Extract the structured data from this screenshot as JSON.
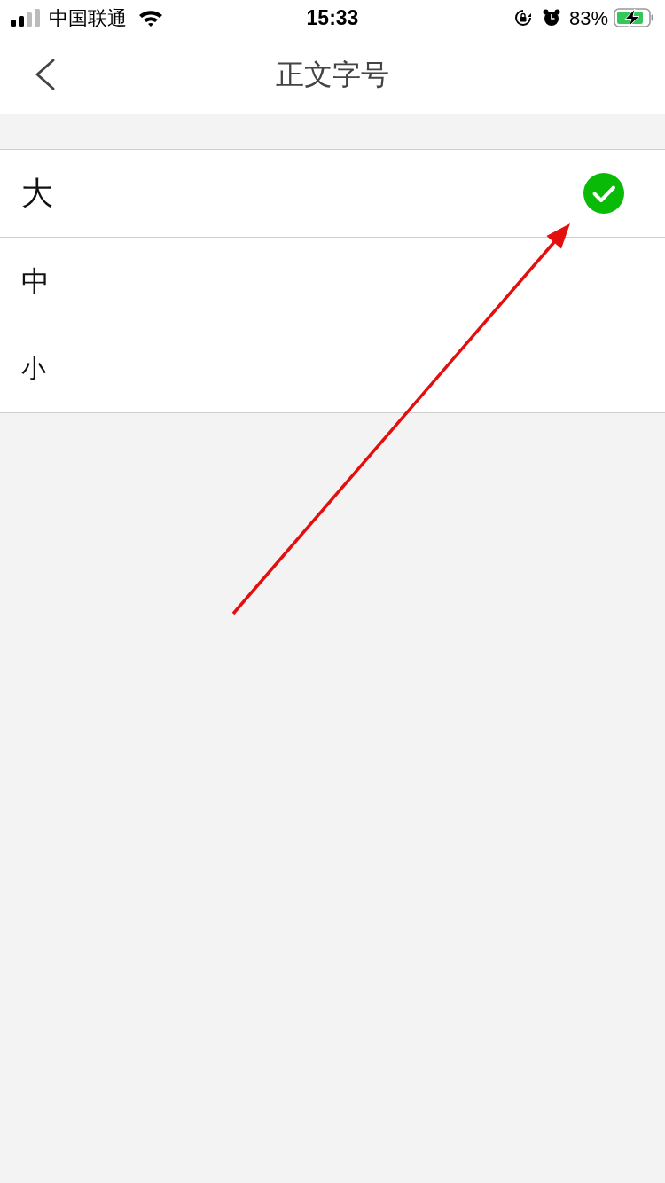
{
  "status_bar": {
    "carrier": "中国联通",
    "time": "15:33",
    "battery_percent": "83%"
  },
  "nav": {
    "title": "正文字号"
  },
  "options": [
    {
      "label": "大",
      "kind": "large",
      "selected": true
    },
    {
      "label": "中",
      "kind": "medium",
      "selected": false
    },
    {
      "label": "小",
      "kind": "small",
      "selected": false
    }
  ]
}
